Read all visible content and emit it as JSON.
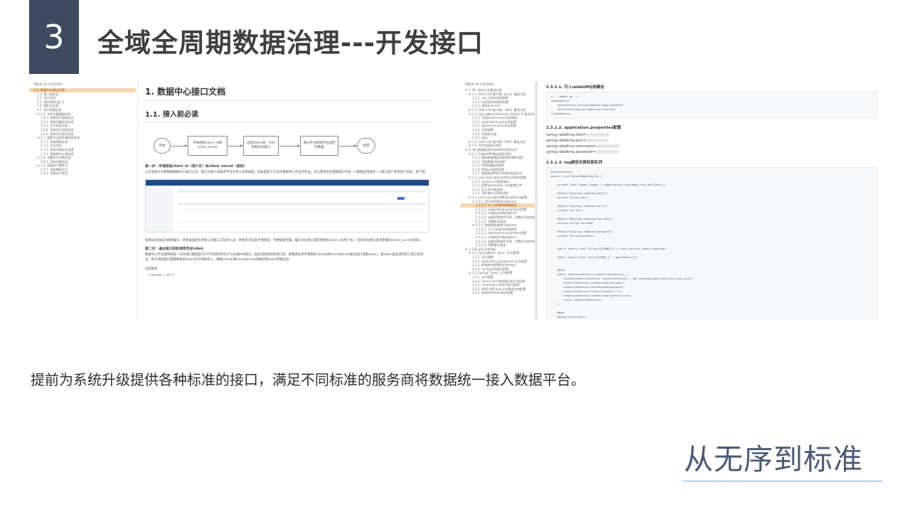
{
  "header": {
    "number": "3",
    "title": "全域全周期数据治理---开发接口"
  },
  "toc1": {
    "title": "Table of Content",
    "items": [
      "⊖ 1. 数据中心接口文档",
      "1.1. 接入前必读",
      "1.2. 用户信息",
      "1.3. 组织机构(部门)",
      "1.4. 教职工信息",
      "1.5. 用户权限信息",
      "⊖ 1.6. 学生学籍基础信息",
      "1.6.1. 获取学生基础信息",
      "1.6.2. 获取学籍异动信息",
      "1.6.3. 学生就业信息",
      "1.6.4. 获取学生奖励信息",
      "1.6.5. 获取学生惩罚信息",
      "⊖ 1.7. 获取专业院系课程表信息",
      "1.7.1. 获取课程信息",
      "1.7.2. 专业信息",
      "1.7.3. 获取学期信息设置",
      "1.7.4. 获取教学计划信息",
      "⊖ 1.8. 学籍学年学期信息",
      "1.8.1. 获取学期信息",
      "⊖ 1.9. 获取部门教职工",
      "1.9.1. 获取教职员工",
      "1.9.2. 获取部门岗位"
    ]
  },
  "doc1": {
    "h1": "1. 数据中心接口文档",
    "h2": "1.1. 接入前必读",
    "flow": [
      "开始",
      "申请获取client_id和client_secret",
      "返回token值，作为参数访问接口",
      "通过平台管理平台返回的数据",
      "结束"
    ],
    "step1": "第一步：申请获取client_id（用户名）和client_secret（密钥）",
    "para1": "三方系统在对接数据数据中心接口之前，需让对接人员联系平台负责人获取帐套。此帐套是三方访问数据中心平台的凭证。可让管理员在数据端口平台—>数据应用授权—>接口用户管理进行添加，如下图：",
    "para2": "管理员添加成功后将编号、密钥发送给负责接入的第三方技术人员，并要求对信息严格保密，不要随意泄漏。编号对应接口请求参数的client_id(用户名)，密钥对应接口请求参数的client_secret(密码)。",
    "step2": "第二步：通过接口获取调用凭证token",
    "para3": "数据中心平台提供的统一对外接口都是基于HTTP请求的RESTful风格API接口。因此调用具体的接口前，都需要先用申请到的clientId和clientSecret通过接口获取token，该token就是调用其它接口的凭证，每次调用接口都需要将此token作为参数传入。根据clientId和clientSecret参数获取token参数信息",
    "version_label": "当前版本",
    "version": "• version = V1.1"
  },
  "toc2": {
    "title": "Table of Content",
    "items": [
      "⊖ 1. 统一身份认证集成方案",
      "⊖ 1.1. SSO-CAS 客户端（Java）集成方案",
      "1.1.1. cas_client添加依赖",
      "1.1.2. 应用程序的跳转配置",
      "1.1.3. 修改web.xml",
      "⊕ 1.2. SSO-CAS 客户端（.Net）集成方案",
      "⊖ 1.3. SpringBoot-Security-OAuth2.0 集成SSO",
      "1.3.1. 添加oauth-security依赖包",
      "1.3.2. application.yml文件配置",
      "1.3.3. Spring Security安全配置",
      "1.3.4. 页面配置",
      "1.3.5. 添加测试类",
      "1.3.6. 启动",
      "⊕ 1.4. SSO-CAS 客户端（PHP）集成方案",
      "⊕ 1.5. API对接接口说明",
      "⊖ 2. 用户数据推送RabbitMQ消息队列",
      "⊖ 2.1. RabbitMQ推送相关说明",
      "2.1.1. 集成数据推送的基本原理和流程",
      "2.1.2. 消息数据字段说明",
      "2.1.3. MQ数据推送频率",
      "2.1.4. MQ队列监控说明",
      "2.1.5. 数据推送MQ队列情况处理方式",
      "⊖ 2.2. Java SpringBoot消息队列相关配置",
      "2.2.1. 在web.xml配置监听",
      "2.2.2. 配置application.xml配置文件",
      "2.2.3. 定义队列路由键",
      "2.2.4. 消息者定义接收消息",
      "⊖ 2.3. Java springboot集成rabbitmq配置",
      "⊖ 2.3.1. 用户新增使用rabbitmq",
      "2.3.1.1. 引入rabbitMQ依赖包",
      "2.3.1.2. application.properties配置",
      "2.3.1.3. mq绑定交换机和队列",
      "2.3.1.4. 自建消费者并声明、消费队列并绑定",
      "2.3.1.5. 消费者实现类",
      "⊖ 2.3.2. 数据更新使用rabbitmq",
      "2.3.2.1. 引入rabbitMQ依赖包",
      "2.3.2.2. application.properties配置",
      "2.3.2.3. mq绑定交换机和队列",
      "2.3.2.4. 自建消费者并声明、消费队列并绑定",
      "2.3.2.5. 消费者实现类",
      "⊖ 3. SSL认证证书升级",
      "⊖ 3.1. SpringBoot（Java）证书配置",
      "3.1.1. 证书配置",
      "3.1.2. application.properties 证书配置",
      "3.1.3. 新增供应配置类支持https",
      "3.1.4. config文件端口配置",
      "⊖ 3.2. Spring（Java）证书配置",
      "3.2.1. 证书配置",
      "3.2.2. server.xml 服务器口和证书配置",
      "3.2.3. conf/web.xml证书安全配置",
      "3.2.4. WEB-INF/web.xml事务支持配置",
      "3.2.5. 新增项目https转发配置"
    ]
  },
  "doc2": {
    "h1": "2.3.1.1. 引入rabbitMQ依赖包",
    "code1": [
      "<!-- rabbit mq -->",
      "<dependency>",
      "    <groupId>org.springframework.amqp</groupId>",
      "    <artifactId>spring-rabbit</artifactId>",
      "</dependency>"
    ],
    "h2": "2.3.1.2. application.properties配置",
    "props": [
      "spring.rabbitmq.host=",
      "spring.rabbitmq.port=",
      "spring.rabbitmq.username=",
      "spring.rabbitmq.password="
    ],
    "h3": "2.3.1.3. mq绑定交换机和队列",
    "code2": [
      "@Configuration",
      "public class FanoutRabbitConfig {",
      "",
      "    private final Logger logger = LoggerFactory.getLogger(this.getClass());",
      "",
      "    @Value(\"${spring.rabbitmq.host}\")",
      "    private String host;",
      "",
      "    @Value(\"${spring.rabbitmq.port}\")",
      "    private int port;",
      "",
      "    @Value(\"${spring.rabbitmq.username}\")",
      "    private String username;",
      "",
      "    @Value(\"${spring.rabbitmq.password}\")",
      "    private String password;",
      "",
      "",
      "    public static final String EXCHANGE_A = \"sync.userinfo.fanout.exchange\";",
      "",
      "    public static final String 队列名_A = \"queueSecurity\";",
      "",
      "",
      "    @Bean",
      "    public ConnectionFactory connectionFactory() {",
      "        CachingConnectionFactory connectionFactory = new CachingConnectionFactory(host,port);",
      "        connectionFactory.setUsername(username);",
      "        connectionFactory.setPassword(password);",
      "        connectionFactory.setVirtualHost(\"/\");",
      "        connectionFactory.setPublisherConfirms(true);",
      "        return connectionFactory;",
      "    }",
      "",
      "    @Bean",
      "    @Scope(\"prototype\")"
    ]
  },
  "description": "提前为系统升级提供各种标准的接口，满足不同标准的服务商将数据统一接入数据平台。",
  "tagline": "从无序到标准"
}
